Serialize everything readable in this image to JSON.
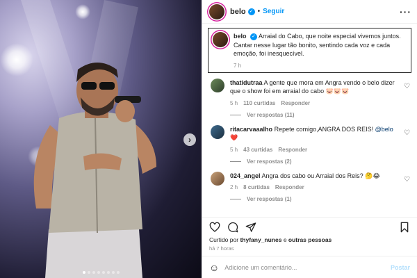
{
  "post": {
    "author": "belo",
    "follow_label": "Seguir",
    "separator": "•",
    "more_icon": "more-horizontal-icon"
  },
  "caption": {
    "username": "belo",
    "text": "Arraial do Cabo, que noite especial vivemos juntos. Cantar nesse lugar tão bonito, sentindo cada voz e cada emoção, foi inesquecível.",
    "time": "7 h"
  },
  "comments": [
    {
      "username": "thatidutraa",
      "text": "A gente que mora em Angra vendo o belo dizer que o show foi em arraial do cabo 🐷🐷🐷",
      "time": "5 h",
      "likes": "110 curtidas",
      "reply": "Responder",
      "view_replies": "Ver respostas (11)"
    },
    {
      "username": "ritacarvaaalho",
      "text": "Repete comigo,ANGRA DOS REIS!",
      "mention": "@belo",
      "emoji": "❤️",
      "time": "5 h",
      "likes": "43 curtidas",
      "reply": "Responder",
      "view_replies": "Ver respostas (2)"
    },
    {
      "username": "024_angel",
      "text": "Angra dos cabo ou Arraial dos Reis? 🤔😂",
      "time": "2 h",
      "likes": "8 curtidas",
      "reply": "Responder",
      "view_replies": "Ver respostas (1)"
    }
  ],
  "likes_line": {
    "prefix": "Curtido por",
    "user": "thyfany_nunes",
    "middle": "e",
    "others": "outras pessoas"
  },
  "posted_ago": "há 7 horas",
  "add_comment": {
    "placeholder": "Adicione um comentário...",
    "post_label": "Postar"
  },
  "carousel": {
    "total": 8,
    "active_index": 0
  },
  "colors": {
    "accent": "#0095f6",
    "verified": "#0095f6",
    "text": "#262626",
    "muted": "#8e8e8e"
  }
}
